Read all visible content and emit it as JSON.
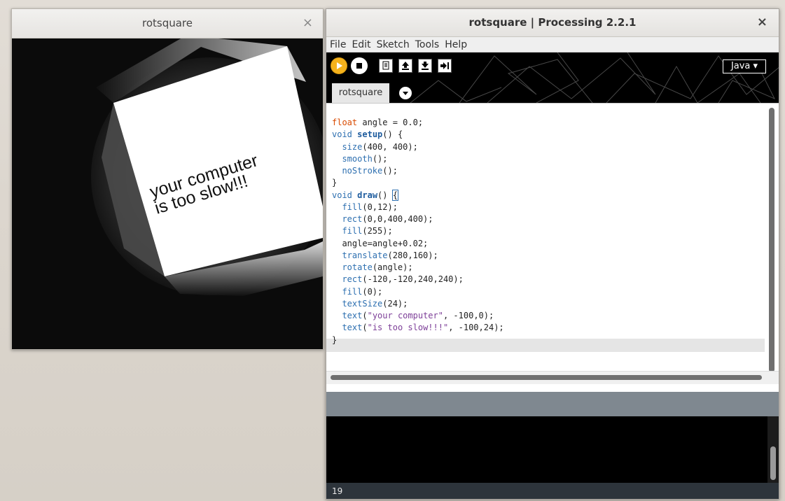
{
  "sketch_window": {
    "title": "rotsquare",
    "close_glyph": "×",
    "canvas": {
      "background": "#0b0b0b",
      "square_color": "#ffffff",
      "text_line1": "your computer",
      "text_line2": "is too slow!!!"
    }
  },
  "pde_window": {
    "title": "rotsquare | Processing 2.2.1",
    "close_glyph": "×",
    "menu": [
      "File",
      "Edit",
      "Sketch",
      "Tools",
      "Help"
    ],
    "toolbar": {
      "run_icon": "play-icon",
      "stop_icon": "stop-icon",
      "new_icon": "new-file-icon",
      "open_icon": "open-up-arrow-icon",
      "save_icon": "save-down-arrow-icon",
      "export_icon": "export-arrow-icon",
      "mode_label": "Java ▾",
      "accent_color": "#f5b21c"
    },
    "tab": {
      "label": "rotsquare",
      "menu_icon": "chevron-down-icon"
    },
    "status": {
      "line_number": "19"
    }
  }
}
